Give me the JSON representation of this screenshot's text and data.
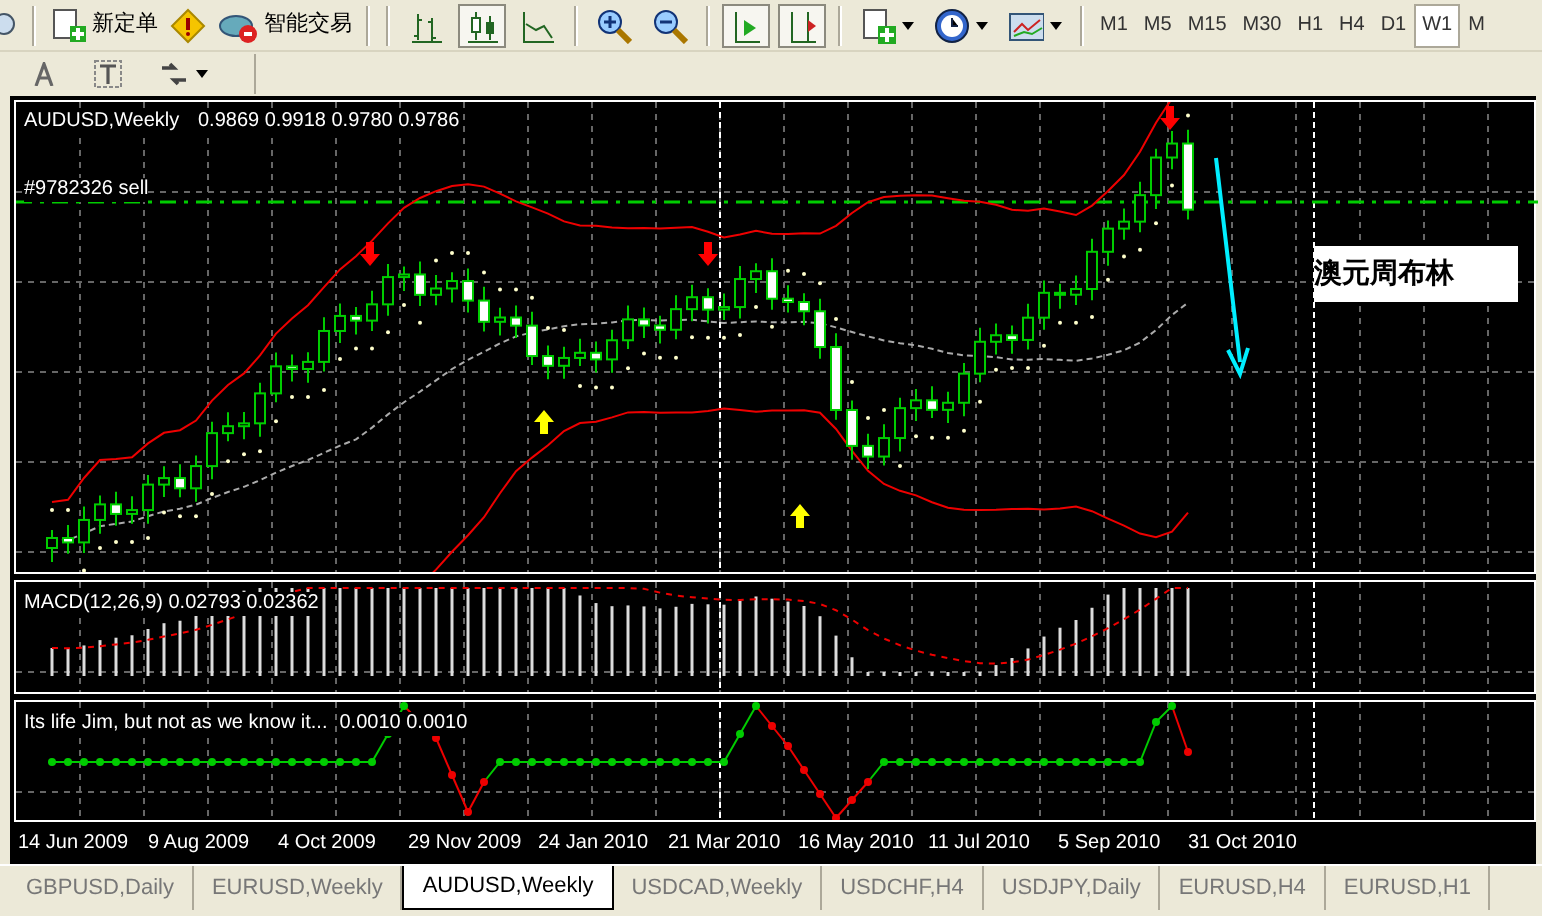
{
  "toolbar": {
    "order_button": {
      "label": "新定单"
    },
    "expert_button": {
      "label": "智能交易"
    },
    "chart_tools": [
      {
        "pressed": false
      },
      {
        "pressed": true
      },
      {
        "pressed": false
      },
      {
        "pressed": false
      },
      {
        "pressed": false
      },
      {
        "pressed": true
      },
      {
        "pressed": true
      }
    ],
    "timeframes": [
      {
        "label": "M1",
        "selected": false
      },
      {
        "label": "M5",
        "selected": false
      },
      {
        "label": "M15",
        "selected": false
      },
      {
        "label": "M30",
        "selected": false
      },
      {
        "label": "H1",
        "selected": false
      },
      {
        "label": "H4",
        "selected": false
      },
      {
        "label": "D1",
        "selected": false
      },
      {
        "label": "W1",
        "selected": true
      },
      {
        "label": "M",
        "selected": false
      }
    ]
  },
  "chart": {
    "title": "AUDUSD,Weekly",
    "prices": "0.9869 0.9918 0.9780 0.9786",
    "order_label": "#9782326 sell",
    "annotation": "澳元周布林"
  },
  "macd": {
    "title": "MACD(12,26,9) 0.02793 0.02362"
  },
  "indicator": {
    "title": "Its life Jim, but not as we know it...",
    "values": "0.0010 0.0010"
  },
  "x_axis": {
    "labels": [
      "14 Jun 2009",
      "9 Aug 2009",
      "4 Oct 2009",
      "29 Nov 2009",
      "24 Jan 2010",
      "21 Mar 2010",
      "16 May 2010",
      "11 Jul 2010",
      "5 Sep 2010",
      "31 Oct 2010"
    ]
  },
  "tabs": [
    {
      "label": "GBPUSD,Daily",
      "selected": false
    },
    {
      "label": "EURUSD,Weekly",
      "selected": false
    },
    {
      "label": "AUDUSD,Weekly",
      "selected": true
    },
    {
      "label": "USDCAD,Weekly",
      "selected": false
    },
    {
      "label": "USDCHF,H4",
      "selected": false
    },
    {
      "label": "USDJPY,Daily",
      "selected": false
    },
    {
      "label": "EURUSD,H4",
      "selected": false
    },
    {
      "label": "EURUSD,H1",
      "selected": false
    }
  ]
}
